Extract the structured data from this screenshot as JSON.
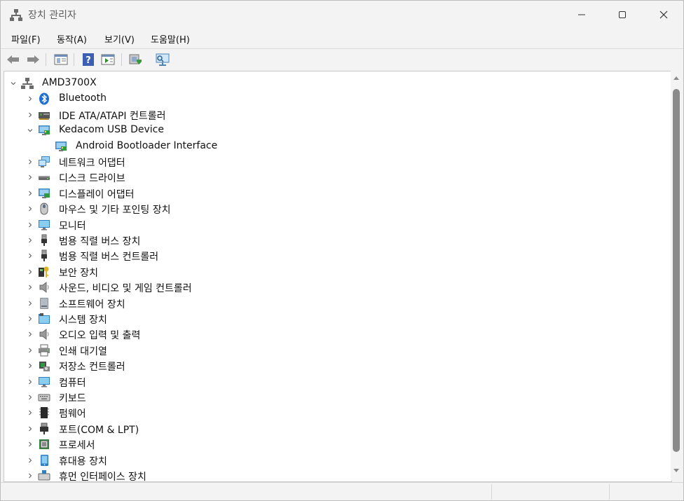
{
  "window": {
    "title": "장치 관리자"
  },
  "menu": [
    "파일(F)",
    "동작(A)",
    "보기(V)",
    "도움말(H)"
  ],
  "toolbar": [
    "back-arrow-icon",
    "forward-arrow-icon",
    "properties-icon",
    "help-icon",
    "update-driver-icon",
    "scan-hardware-icon",
    "display-device-icon"
  ],
  "tree": {
    "root": "AMD3700X",
    "items": [
      {
        "label": "Bluetooth",
        "icon": "bluetooth-icon",
        "expanded": false
      },
      {
        "label": "IDE ATA/ATAPI 컨트롤러",
        "icon": "ide-controller-icon",
        "expanded": false
      },
      {
        "label": "Kedacom USB Device",
        "icon": "usb-device-icon",
        "expanded": true,
        "children": [
          {
            "label": "Android Bootloader Interface",
            "icon": "usb-device-icon"
          }
        ]
      },
      {
        "label": "네트워크 어댑터",
        "icon": "network-adapter-icon",
        "expanded": false
      },
      {
        "label": "디스크 드라이브",
        "icon": "disk-drive-icon",
        "expanded": false
      },
      {
        "label": "디스플레이 어댑터",
        "icon": "display-adapter-icon",
        "expanded": false
      },
      {
        "label": "마우스 및 기타 포인팅 장치",
        "icon": "mouse-icon",
        "expanded": false
      },
      {
        "label": "모니터",
        "icon": "monitor-icon",
        "expanded": false
      },
      {
        "label": "범용 직렬 버스 장치",
        "icon": "usb-plug-icon",
        "expanded": false
      },
      {
        "label": "범용 직렬 버스 컨트롤러",
        "icon": "usb-plug-icon",
        "expanded": false
      },
      {
        "label": "보안 장치",
        "icon": "security-key-icon",
        "expanded": false
      },
      {
        "label": "사운드, 비디오 및 게임 컨트롤러",
        "icon": "speaker-icon",
        "expanded": false
      },
      {
        "label": "소프트웨어 장치",
        "icon": "software-device-icon",
        "expanded": false
      },
      {
        "label": "시스템 장치",
        "icon": "system-folder-icon",
        "expanded": false
      },
      {
        "label": "오디오 입력 및 출력",
        "icon": "speaker-icon",
        "expanded": false
      },
      {
        "label": "인쇄 대기열",
        "icon": "printer-icon",
        "expanded": false
      },
      {
        "label": "저장소 컨트롤러",
        "icon": "storage-controller-icon",
        "expanded": false
      },
      {
        "label": "컴퓨터",
        "icon": "monitor-icon",
        "expanded": false
      },
      {
        "label": "키보드",
        "icon": "keyboard-icon",
        "expanded": false
      },
      {
        "label": "펌웨어",
        "icon": "firmware-chip-icon",
        "expanded": false
      },
      {
        "label": "포트(COM & LPT)",
        "icon": "port-icon",
        "expanded": false
      },
      {
        "label": "프로세서",
        "icon": "processor-icon",
        "expanded": false
      },
      {
        "label": "휴대용 장치",
        "icon": "portable-device-icon",
        "expanded": false
      },
      {
        "label": "휴먼 인터페이스 장치",
        "icon": "hid-icon",
        "expanded": false
      }
    ]
  }
}
